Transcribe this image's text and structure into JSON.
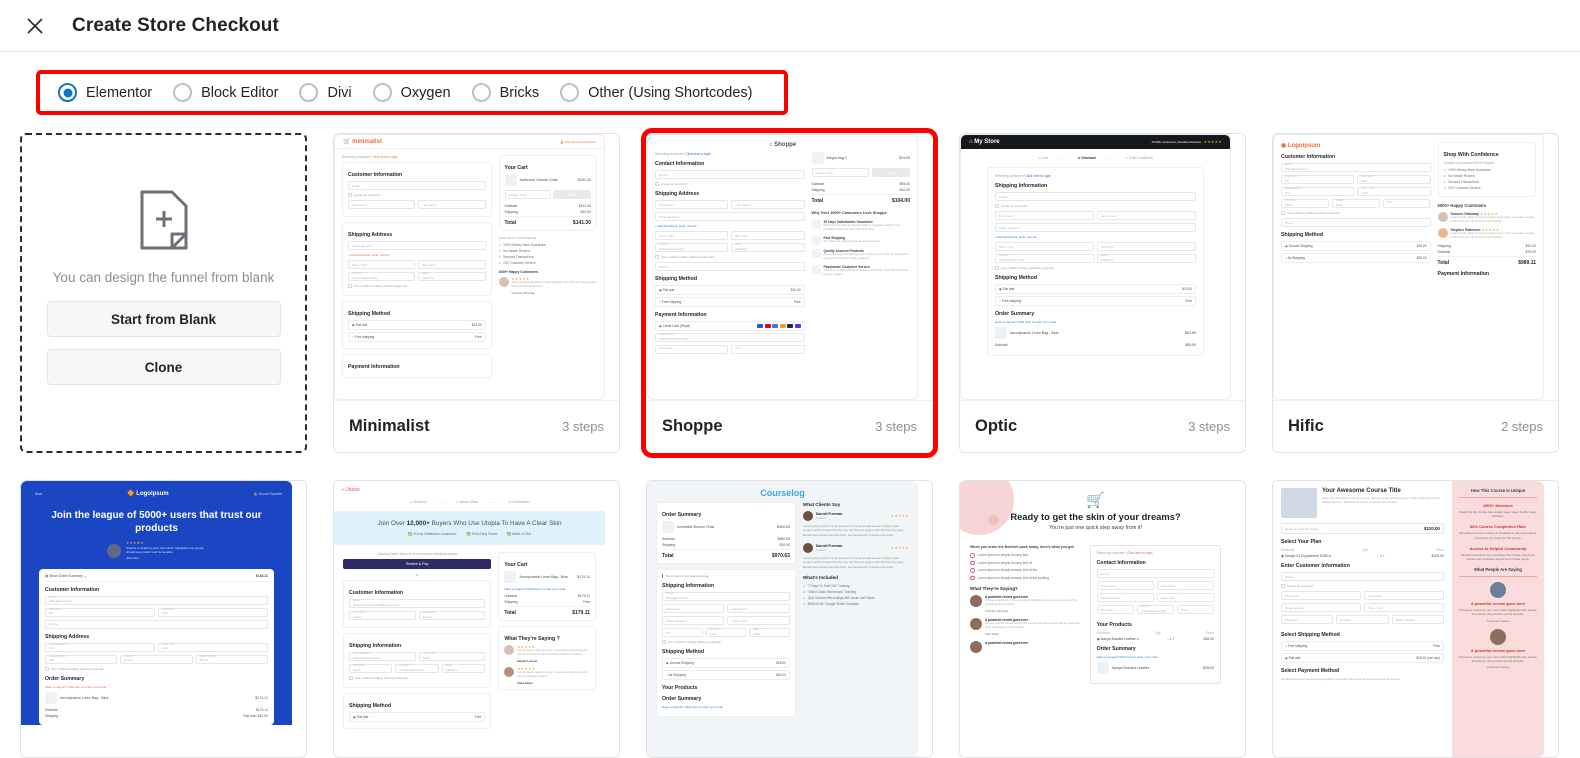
{
  "header": {
    "close_icon": "close-icon",
    "title": "Create Store Checkout"
  },
  "builders": {
    "options": [
      {
        "label": "Elementor",
        "selected": true
      },
      {
        "label": "Block Editor",
        "selected": false
      },
      {
        "label": "Divi",
        "selected": false
      },
      {
        "label": "Oxygen",
        "selected": false
      },
      {
        "label": "Bricks",
        "selected": false
      },
      {
        "label": "Other (Using Shortcodes)",
        "selected": false
      }
    ],
    "highlight_color": "#ff0000",
    "accent_color": "#1174c4"
  },
  "blank_card": {
    "icon": "add-page-icon",
    "description": "You can design the funnel from blank",
    "start_label": "Start from Blank",
    "clone_label": "Clone"
  },
  "templates": [
    {
      "name": "Minimalist",
      "steps": "3 steps",
      "selected": false,
      "mock": {
        "logo": "minimalist",
        "badge": "SSL Secured Checkout",
        "returning": "Returning customer?",
        "returning_link": "Click here to login",
        "section1": "Customer Information",
        "email_ph": "Email *",
        "create_account": "Create an account?",
        "first_ph": "First name *",
        "last_ph": "Last name *",
        "section2": "Shipping Address",
        "street_ph": "Street address *",
        "apt_link": "+ Add Apartment, suite, unit etc.",
        "city_ph": "Town / City *",
        "zip_ph": "ZIP Code *",
        "country_ph": "United States (US)",
        "state_ph": "Alabama",
        "billing_chk": "Use a different billing address (optional)",
        "section3": "Shipping Method",
        "ship1": "Flat rate",
        "ship1_price": "$13.00",
        "ship2": "Free shipping",
        "ship2_price": "Free",
        "section4": "Payment Information",
        "cart_title": "Your Cart",
        "cart_item": "Awesome Granite Chair",
        "cart_price": "$131.30",
        "coupon_ph": "Coupon code",
        "apply": "Apply",
        "subtotal_l": "Subtotal",
        "subtotal_v": "$131.30",
        "shipping_l": "Shipping",
        "shipping_v": "$10.00",
        "total_l": "Total",
        "total_v": "$141.30",
        "confidence_title": "SHOP WITH CONFIDENCE",
        "confidence": [
          "100% Money Back Guarantee",
          "No Hassle Returns",
          "Secured Transactions",
          "24/7 Customer Service"
        ],
        "happy_title": "1000+ Happy Customers",
        "review": "Add a testimonial which should highlight why they use this product and how it benefits them.",
        "reviewer": "Christina McVeigh"
      }
    },
    {
      "name": "Shoppe",
      "steps": "3 steps",
      "selected": true,
      "mock": {
        "logo": "Shoppe",
        "returning": "Returning customer?",
        "returning_link": "Click here to login",
        "section1": "Contact Information",
        "email_ph": "Email *",
        "create_account": "Create an account?",
        "section2": "Shipping Address",
        "first_ph": "First name *",
        "last_ph": "Last name *",
        "street_ph": "Street address *",
        "apt_link": "+ Add Apartment, suite, unit etc.",
        "city_ph": "Town / City",
        "zip_ph": "ZIP Code",
        "country_label": "Country *",
        "country_val": "United States (US)",
        "state_label": "State *",
        "state_val": "Alabama",
        "billing_chk": "Use a different billing address (optional)",
        "phone_ph": "Phone",
        "section3": "Shipping Method",
        "ship1": "Flat rate",
        "ship1_price": "$10.00",
        "ship2": "Free shipping",
        "ship2_price": "Free",
        "section4": "Payment Information",
        "pay_method": "Credit Card (Stripe)",
        "card_label": "Card number *",
        "card_ph": "1234 1234 1234 1234",
        "expiry_label": "Expiry date *",
        "cvc_label": "CVC *",
        "cart_item": "Alegra bag 1",
        "cart_price": "$24.00",
        "coupon_ph": "Coupon code",
        "apply": "Apply",
        "subtotal_l": "Subtotal",
        "subtotal_v": "$94.00",
        "shipping_l": "Shipping",
        "shipping_v": "$10.00",
        "total_l": "Total",
        "total_v": "$104.00",
        "why_title": "Why Over 1500+ Customers Love Shoppe",
        "features": [
          {
            "t": "30 Days Satisfaction Guarantee",
            "d": "Don't like something? Need it back or questions asked! Just email@shoppe.com and we'll take care"
          },
          {
            "t": "Fast Shipping",
            "d": "All orders are shipped from local warehouse"
          },
          {
            "t": "Quality Assured Products",
            "d": "All products go through rigorous testing ensure that our customers receive the highest quality products."
          },
          {
            "t": "Passionate Customer Service",
            "d": "Call us at +1-800-555-0175 between 9:00 AM - 5:00 PM local time for any support"
          }
        ]
      }
    },
    {
      "name": "Optic",
      "steps": "3 steps",
      "selected": false,
      "mock": {
        "logo": "My Store",
        "badge": "15,000+ Customers  |  Excellent Reviews",
        "steps_nav": [
          "Cart",
          "Checkout",
          "Order Confirmed"
        ],
        "returning": "Returning customer?",
        "returning_link": "Click here to login",
        "section1": "Shipping Information",
        "email_ph": "Email *",
        "create_account": "Create an account?",
        "first_ph": "First name *",
        "last_ph": "Last name *",
        "street_ph": "Street address *",
        "apt_link": "+ Add Apartment, suite, unit etc.",
        "city_ph": "Town / City",
        "zip_ph": "ZIP Code",
        "country_label": "Country *",
        "country_val": "United States (US)",
        "state_label": "State *",
        "state_val": "Alabama",
        "billing_chk": "Use a different billing address (optional)",
        "section3": "Shipping Method",
        "ship1": "Flat rate",
        "ship1_price": "$10.00",
        "ship2": "Free shipping",
        "ship2_price": "Free",
        "summary_title": "Order Summary",
        "cart_item": "Aerodynamic Linen Bag - Blue",
        "cart_price": "$63.89",
        "coupon_link": "Have a coupon? Click here to enter your code",
        "subtotal_l": "Subtotal",
        "subtotal_v": "$63.89"
      }
    },
    {
      "name": "Hific",
      "steps": "2 steps",
      "selected": false,
      "mock": {
        "logo": "Logoipsum",
        "section1": "Customer Information",
        "email_label": "Email *",
        "email_val": "billing@mail.com",
        "first_label": "First name *",
        "first_val": "KK",
        "last_label": "Last name *",
        "last_val": "KKK",
        "street_label": "Street address *",
        "street_val": "sfsf",
        "city_label": "Town / City *",
        "city_val": "sndd",
        "zip_label": "Pin Code *",
        "zip_val": "0000",
        "country_label": "Country *",
        "country_val": "India",
        "state_label": "State",
        "billing_chk": "Use a different billing address (optional)",
        "phone_ph": "Phone",
        "section2": "Shipping Method",
        "ship1": "Ground Shipping",
        "ship1_price": "$18.00",
        "ship2": "Air Shipping",
        "ship2_price": "$20.00",
        "summary_title": "Order Summary",
        "cart_item": "Aerodynamic Linen Bag - Blue",
        "cart_price": "$79.00",
        "subtotal_l": "Subtotal",
        "subtotal_v": "$79.00",
        "shipping_l": "Shipping",
        "shipping_v": "$10.00",
        "total_l": "Total",
        "total_v": "$989.11",
        "payment_title": "Payment Information",
        "confidence_title": "Shop With Confidence",
        "confidence_sub": "Trusted by more than 5000+ buyers",
        "confidence": [
          "100% Money-Back Guarantee",
          "No Hassle Returns",
          "Secured Transactions",
          "24/7 Customer Service"
        ],
        "happy_title": "5000+ Happy Customers",
        "r1_name": "Dolores Galloway",
        "r1_text": "Lorem ipsum dolor sit amet pretium nunc lorem venenatis semper at rhoncus nec. Sit rhoncus sem blandit.",
        "r2_name": "Stephen Patterson",
        "r2_text": "Lorem ipsum dolor sit amet pretium lorem nunc venenatis semper at rhoncus nec. Sit rhoncus sem blandit."
      }
    },
    {
      "name": "",
      "steps": "",
      "selected": false,
      "row2": true,
      "mock": {
        "kind": "blue-hero",
        "back": "Back",
        "logo": "Logoipsum",
        "secure": "Secure Payment",
        "headline": "Join the league of 5000+ users that trust our products",
        "quote": "Choose a review by your user which highlights why people should use product and its benefits.",
        "quote_author": "John Doe",
        "summary_toggle": "Show Order Summary",
        "summary_total": "$184.11",
        "section1": "Customer Information",
        "email_label": "Email *",
        "email_val": "billing@mail.com",
        "first_label": "First name *",
        "first_val": "KK",
        "last_label": "Last name *",
        "last_val": "KKK",
        "phone_ph": "Phone",
        "section2": "Shipping Address",
        "street_label": "Street address *",
        "street_val": "sfsf",
        "city_label": "Town / City *",
        "city_val": "sndd",
        "zip_label": "Postcode / ZIP *",
        "zip_val": "000",
        "country_label": "Country *",
        "country_val": "Eritrea",
        "state_label": "State / County *",
        "state_val": "Debub",
        "billing_chk": "Use a different billing address (optional)",
        "section3": "Order Summary",
        "coupon_link": "Have a coupon? Click here to enter your code",
        "cart_item": "Aerodynamic Linen Bag - Blue",
        "cart_price": "$174.11",
        "subtotal_l": "Subtotal",
        "subtotal_v": "$174.11",
        "shipping_l": "Shipping",
        "shipping_v": "Flat rate: $10.00"
      }
    },
    {
      "name": "",
      "steps": "",
      "selected": false,
      "row2": true,
      "mock": {
        "kind": "utopia",
        "logo": "Utopia",
        "steps_nav": [
          "Checkout",
          "Bonus Offers",
          "Confirmation"
        ],
        "band_pre": "Join Over ",
        "band_num": "12,000+",
        "band_post": " Buyers Who Use Utopia To Have A Clear Skin",
        "badges": [
          "30-Day Satisfaction Guarantee",
          "Third-Party Tested",
          "Made in USA"
        ],
        "express": "Checkout faster with one of our express checkout options",
        "express_btn": "Review & Pay",
        "or": "or",
        "section1": "Customer Information",
        "email_label": "Email",
        "email_val": "akashnamelookoutdfif@gmail.com",
        "first_label": "First name *",
        "first_val": "Akash",
        "last_label": "Last name *",
        "last_val": "Anand",
        "section2": "Shipping Information",
        "street_label": "Street address *",
        "street_val": "180a Haralds Tower",
        "city_label": "Town / City *",
        "city_val": "Surat",
        "zip_label": "ZIP Code",
        "zip_val": "Spain",
        "country_label": "Country *",
        "country_val": "United States (US)",
        "state_label": "State",
        "state_val": "Alabama",
        "billing_chk": "Use a different billing address (optional)",
        "section3": "Shipping Method",
        "ship1": "Flat rate",
        "ship1_price": "Free",
        "cart_title": "Your Cart",
        "cart_item": "Aerodynamic Linen Bag - Blue",
        "cart_price": "$179.11",
        "coupon_link": "Have a coupon? Click here to enter your code",
        "subtotal_l": "Subtotal",
        "subtotal_v": "$179.11",
        "shipping_l": "Shipping",
        "shipping_v": "Free",
        "total_l": "Total",
        "total_v": "$179.11",
        "saying_title": "What They're Saying ?",
        "r1_text": "Lorem ipsum dolor sit amet, consectetur adipiscing elit, sed do eiusmod tempor incididunt labore et dolore.",
        "r1_name": "Beatty Larson",
        "r2_text": "Lorem ipsum dolor sit amet, consectetur adipiscing elit, sed do eiusmod tempor.",
        "r2_name": "Paul Adam"
      }
    },
    {
      "name": "",
      "steps": "",
      "selected": false,
      "row2": true,
      "mock": {
        "kind": "courselog",
        "logo": "Courselog",
        "summary_title": "Order Summary",
        "cart_item": "Incredible Bronze Chair",
        "cart_price": "$960.63",
        "subtotal_l": "Subtotal",
        "subtotal_v": "$960.63",
        "shipping_l": "Shipping",
        "shipping_v": "$10.00",
        "total_l": "Total",
        "total_v": "$970.63",
        "notice": "No product in the checkout page",
        "section1": "Shipping Information",
        "email_label": "Email *",
        "email_val": "billing@mail.com",
        "first_ph": "First name *",
        "last_ph": "Last name *",
        "street_ph": "Street address *",
        "city_ph": "Town / City *",
        "zip_ph": "Pin *",
        "country_label": "Country *",
        "country_val": "India",
        "state_label": "State *",
        "state_val": "India",
        "billing_chk": "Use a different billing address (optional)",
        "section2": "Shipping Method",
        "ship1": "Ground Shipping",
        "ship1_price": "$18.00",
        "ship2": "Air Shipping",
        "ship2_price": "$20.00",
        "section3": "Your Products",
        "section4": "Order Summary",
        "coupon_link": "Have a coupon? Click here to enter your code",
        "clients_title": "What Clients Say",
        "r1_name": "Darnell Freeman",
        "r1_role": "Student",
        "r1_text": "\"Lorem ipsum dolor si amet parturient nunc venenatis aenean ultricies eget semper eleifend quam rhoncus nec. Sit rhoncus sapien parturient sempe quam blandit nisi porttitor eget lore dolor. Feugiat aenean imperdiet vel nulla.\"",
        "r2_name": "Darnell Freeman",
        "r2_role": "Student",
        "r2_text": "\"Lorem ipsum dolor si amet parturient nunc venenatis aenean ultricies eget semper eleifend quam rhoncus nec. Sit rhoncus sapien parturient sempe quam blandit nisi porttitor eget lore dolor. Feugiat aenean imperdiet vel nulla.\"",
        "included_title": "What's Included",
        "included": [
          "\"7 Days To Sold Out\" Training",
          "\"World Class Workshops\" Training",
          "Q&A Session Recordings with Justin and Sarah",
          "BONUS #3: Google Slides Template"
        ]
      }
    },
    {
      "name": "",
      "steps": "",
      "selected": false,
      "row2": true,
      "mock": {
        "kind": "skin",
        "cart_icon": "shopping-cart-icon",
        "headline": "Ready to get the skin of your dreams?",
        "sub": "You're just one quick step away from it!",
        "order_title": "When you order the Beehive pack today, here's what you get:",
        "bullets": [
          "Lorem ipsum is simply dummy text",
          "Lorem ipsum is simply dummy text of",
          "Lorem ipsum is simply dummy text of the",
          "Lorem ipsum is simply dummy text of the printing"
        ],
        "saying_title": "What They're Saying?",
        "r1_title": "A powerful review goes here",
        "r1_text": "Choose a review by your user which highlights why people should use this product and its benefits.",
        "r1_name": "Christine McVeigh",
        "r2_title": "A powerful review goes here",
        "r2_text": "Choose another review which tells people how this product has an edge over other alternatives in the market.",
        "r2_name": "Paul Adam",
        "r3_title": "A powerful review goes here",
        "returning": "Returning customer?",
        "returning_link": "Click here to login",
        "section1": "Contact Information",
        "email_ph": "Email *",
        "first_ph": "First name *",
        "last_ph": "Last name *",
        "street_ph": "Street address *",
        "city_ph": "Town / City *",
        "zip_ph": "ZIP Code *",
        "country_label": "Country *",
        "country_val": "United States (US)",
        "state_ph": "State *",
        "section2": "Your Products",
        "col_products": "Products",
        "col_qty": "Qty",
        "col_price": "Price",
        "prod_name": "Alanya Braided Leather n",
        "prod_qty": "1",
        "prod_price": "$28.00",
        "section3": "Order Summary",
        "coupon_link": "Have a coupon? Click here to enter your code",
        "sum_item": "Alanya Braided Leather",
        "sum_price": "$28.00"
      }
    },
    {
      "name": "",
      "steps": "",
      "selected": false,
      "row2": true,
      "mock": {
        "kind": "course-pink",
        "course_title": "Your Awesome Course Title",
        "course_desc": "Enter the description of your course. Mention what problem does it help solve and what's unique about it. Tantalize on how it would benefit people.",
        "summary_toggle": "Show Order Summary",
        "summary_total": "$120.00",
        "section1": "Select Your Plan",
        "col_products": "Products",
        "col_qty": "Qty",
        "col_price": "Price",
        "plan_name": "Simple 03 Supplement 6768 ct",
        "plan_qty": "1",
        "plan_price": "$105.00",
        "section2": "Enter Customer Information",
        "email_ph": "Email",
        "create_account": "Create an account?",
        "first_ph": "First name",
        "last_ph": "Last name",
        "street_ph": "Street address",
        "city_ph": "Town / City",
        "zip_ph": "Postcode",
        "country_ph": "Country",
        "state_ph": "State / County",
        "section3": "Select Shipping Method",
        "ship1": "Free shipping",
        "ship1_price": "Free",
        "ship2": "Flat rate",
        "ship2_price": "$15.00 (incl. tax)",
        "section4": "Select Payment Method",
        "pay_note": "All transactions are secure and encrypted. Credit card information is never stored on our servers.",
        "unique_title": "How This Course is Unique",
        "u1_t": "1500+ Members",
        "u1_d": "State that the course has already been taken by this many members.",
        "u2_t": "80% Course Completion Rate",
        "u2_d": "Emphasize on the number of available on-demand videos or lectures you have for this course.",
        "u3_t": "Access to Helpful Community",
        "u3_d": "Mention that when they purchase this course, they'll get instant and exclusive access to a private group.",
        "saying_title": "What People Are Saying",
        "r1_title": "A powerful review goes here",
        "r1_text": "Choose a review by your user which highlights why people should use this product and its benefits.",
        "r1_name": "Customer Name",
        "r2_title": "A powerful review goes here",
        "r2_text": "Choose a review by your user which highlights why people should use this product and its benefits.",
        "r2_name": "Customer Name"
      }
    }
  ]
}
